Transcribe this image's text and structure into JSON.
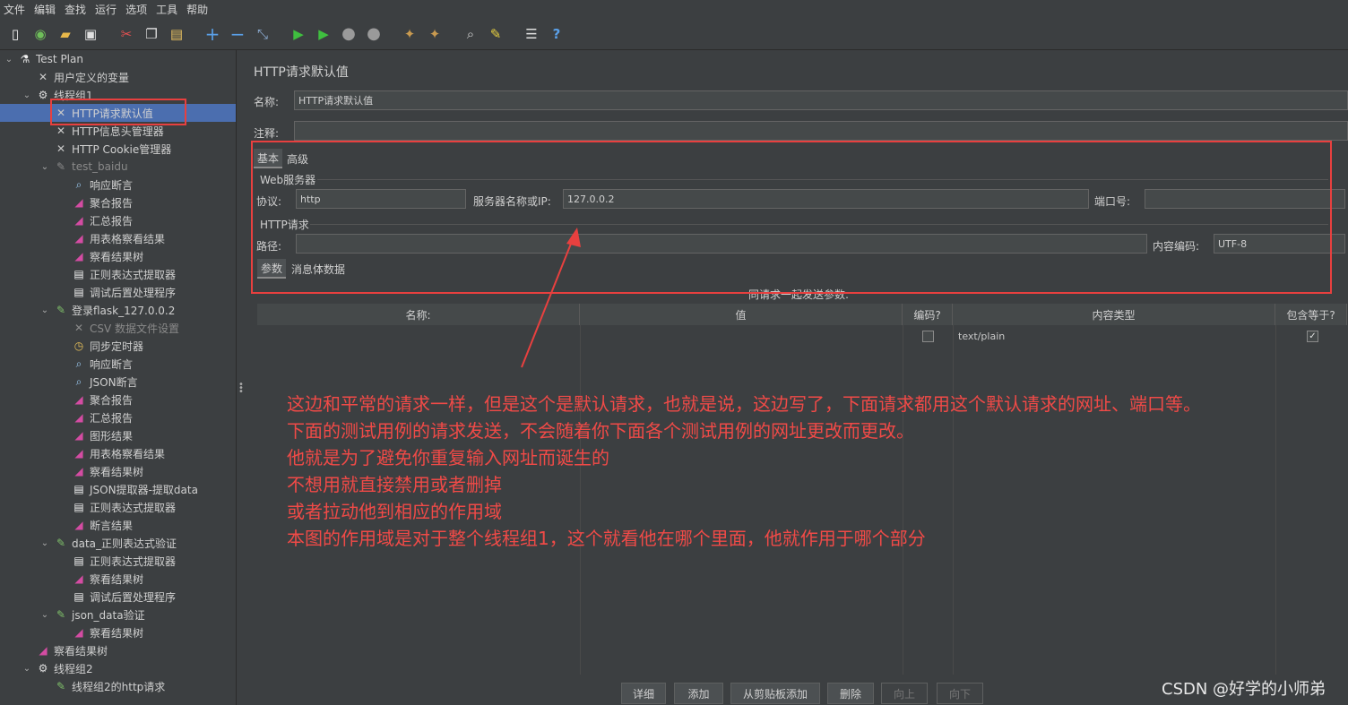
{
  "menu": [
    "文件",
    "编辑",
    "查找",
    "运行",
    "选项",
    "工具",
    "帮助"
  ],
  "tree": [
    {
      "label": "Test Plan",
      "icon": "flask-icon"
    },
    {
      "label": "用户定义的变量",
      "icon": "wrench-icon"
    },
    {
      "label": "线程组1",
      "icon": "gear-icon"
    },
    {
      "label": "HTTP请求默认值",
      "icon": "wrench-icon"
    },
    {
      "label": "HTTP信息头管理器",
      "icon": "wrench-icon"
    },
    {
      "label": "HTTP Cookie管理器",
      "icon": "wrench-icon"
    },
    {
      "label": "test_baidu",
      "icon": "pen-icon"
    },
    {
      "label": "响应断言",
      "icon": "magnifier-icon"
    },
    {
      "label": "聚合报告",
      "icon": "chart-icon"
    },
    {
      "label": "汇总报告",
      "icon": "chart-icon"
    },
    {
      "label": "用表格察看结果",
      "icon": "chart-icon"
    },
    {
      "label": "察看结果树",
      "icon": "chart-icon"
    },
    {
      "label": "正则表达式提取器",
      "icon": "document-icon"
    },
    {
      "label": "调试后置处理程序",
      "icon": "document-icon"
    },
    {
      "label": "登录flask_127.0.0.2",
      "icon": "pen-icon"
    },
    {
      "label": "CSV 数据文件设置",
      "icon": "wrench-icon"
    },
    {
      "label": "同步定时器",
      "icon": "timer-icon"
    },
    {
      "label": "响应断言",
      "icon": "magnifier-icon"
    },
    {
      "label": "JSON断言",
      "icon": "magnifier-icon"
    },
    {
      "label": "聚合报告",
      "icon": "chart-icon"
    },
    {
      "label": "汇总报告",
      "icon": "chart-icon"
    },
    {
      "label": "图形结果",
      "icon": "chart-icon"
    },
    {
      "label": "用表格察看结果",
      "icon": "chart-icon"
    },
    {
      "label": "察看结果树",
      "icon": "chart-icon"
    },
    {
      "label": "JSON提取器-提取data",
      "icon": "document-icon"
    },
    {
      "label": "正则表达式提取器",
      "icon": "document-icon"
    },
    {
      "label": "断言结果",
      "icon": "chart-icon"
    },
    {
      "label": "data_正则表达式验证",
      "icon": "pen-icon"
    },
    {
      "label": "正则表达式提取器",
      "icon": "document-icon"
    },
    {
      "label": "察看结果树",
      "icon": "chart-icon"
    },
    {
      "label": "调试后置处理程序",
      "icon": "document-icon"
    },
    {
      "label": "json_data验证",
      "icon": "pen-icon"
    },
    {
      "label": "察看结果树",
      "icon": "chart-icon"
    },
    {
      "label": "察看结果树",
      "icon": "chart-icon"
    },
    {
      "label": "线程组2",
      "icon": "gear-icon"
    },
    {
      "label": "线程组2的http请求",
      "icon": "pen-icon"
    }
  ],
  "panel": {
    "title": "HTTP请求默认值",
    "name_label": "名称:",
    "name_value": "HTTP请求默认值",
    "comment_label": "注释:",
    "tabs": [
      "基本",
      "高级"
    ],
    "web_server_group": "Web服务器",
    "protocol_label": "协议:",
    "protocol_value": "http",
    "server_label": "服务器名称或IP:",
    "server_value": "127.0.0.2",
    "port_label": "端口号:",
    "http_request_group": "HTTP请求",
    "path_label": "路径:",
    "encoding_label": "内容编码:",
    "encoding_value": "UTF-8",
    "sub_tabs": [
      "参数",
      "消息体数据"
    ],
    "params_caption": "同请求一起发送参数:"
  },
  "table": {
    "headers": [
      "名称:",
      "值",
      "编码?",
      "内容类型",
      "包含等于?"
    ],
    "rows": [
      {
        "name": "",
        "value": "",
        "encode": false,
        "content_type": "text/plain",
        "include_equals": true
      }
    ]
  },
  "buttons": [
    "详细",
    "添加",
    "从剪贴板添加",
    "删除",
    "向上",
    "向下"
  ],
  "annotation": [
    "这边和平常的请求一样，但是这个是默认请求，也就是说，这边写了，下面请求都用这个默认请求的网址、端口等。",
    "下面的测试用例的请求发送，不会随着你下面各个测试用例的网址更改而更改。",
    "他就是为了避免你重复输入网址而诞生的",
    "不想用就直接禁用或者删掉",
    "或者拉动他到相应的作用域",
    "本图的作用域是对于整个线程组1，这个就看他在哪个里面，他就作用于哪个部分"
  ],
  "watermark": "CSDN @好学的小师弟",
  "colors": {
    "annotation_red": "#e8403f",
    "selection_blue": "#4b6eaf",
    "background": "#3c3f41"
  }
}
